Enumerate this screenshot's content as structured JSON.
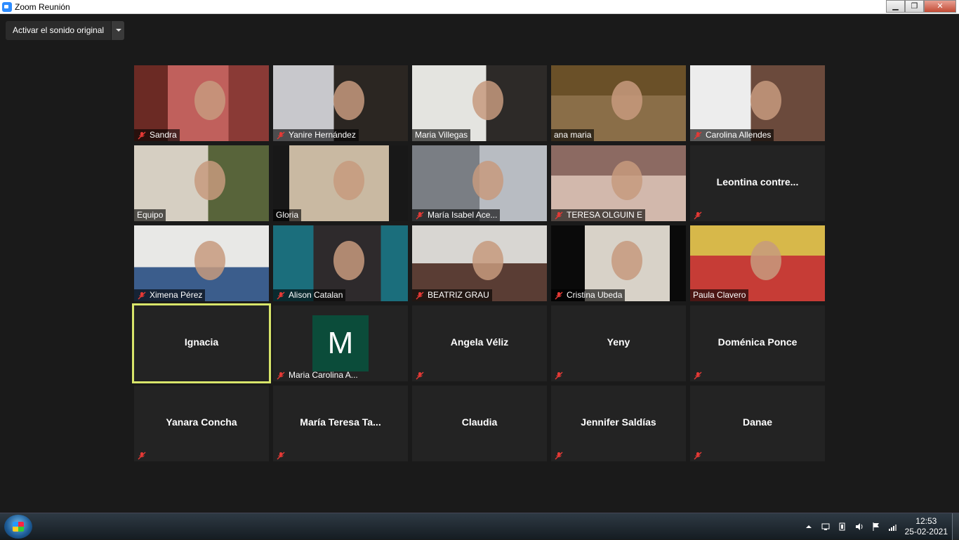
{
  "window": {
    "title": "Zoom Reunión",
    "minimize": "▁",
    "maximize": "❐",
    "close": "✕"
  },
  "audio": {
    "label": "Activar el sonido original"
  },
  "participants": [
    {
      "name": "Sandra",
      "muted": true,
      "video": true
    },
    {
      "name": "Yanire Hernández",
      "muted": true,
      "video": true
    },
    {
      "name": "Maria Villegas",
      "muted": false,
      "video": true
    },
    {
      "name": "ana maria",
      "muted": false,
      "video": true
    },
    {
      "name": "Carolina Allendes",
      "muted": true,
      "video": true
    },
    {
      "name": "Equipo",
      "muted": false,
      "video": true
    },
    {
      "name": "Gloria",
      "muted": false,
      "video": true
    },
    {
      "name": "María Isabel Ace...",
      "muted": true,
      "video": true
    },
    {
      "name": "TERESA OLGUIN E",
      "muted": true,
      "video": true
    },
    {
      "name": "Leontina  contre...",
      "muted": true,
      "video": false
    },
    {
      "name": "Ximena Pérez",
      "muted": true,
      "video": true
    },
    {
      "name": "Alison Catalan",
      "muted": true,
      "video": true
    },
    {
      "name": "BEATRIZ GRAU",
      "muted": true,
      "video": true
    },
    {
      "name": "Cristina Ubeda",
      "muted": true,
      "video": true
    },
    {
      "name": "Paula Clavero",
      "muted": false,
      "video": true
    },
    {
      "name": "Ignacia",
      "muted": false,
      "video": false,
      "active": true
    },
    {
      "name": "Maria Carolina A...",
      "muted": true,
      "video": false,
      "avatar": "M"
    },
    {
      "name": "Angela  Véliz",
      "muted": true,
      "video": false
    },
    {
      "name": "Yeny",
      "muted": true,
      "video": false
    },
    {
      "name": "Doménica Ponce",
      "muted": true,
      "video": false
    },
    {
      "name": "Yanara Concha",
      "muted": true,
      "video": false
    },
    {
      "name": "María Teresa Ta...",
      "muted": true,
      "video": false
    },
    {
      "name": "Claudia",
      "muted": false,
      "video": false
    },
    {
      "name": "Jennifer Saldías",
      "muted": true,
      "video": false
    },
    {
      "name": "Danae",
      "muted": true,
      "video": false
    }
  ],
  "taskbar": {
    "time": "12:53",
    "date": "25-02-2021"
  }
}
